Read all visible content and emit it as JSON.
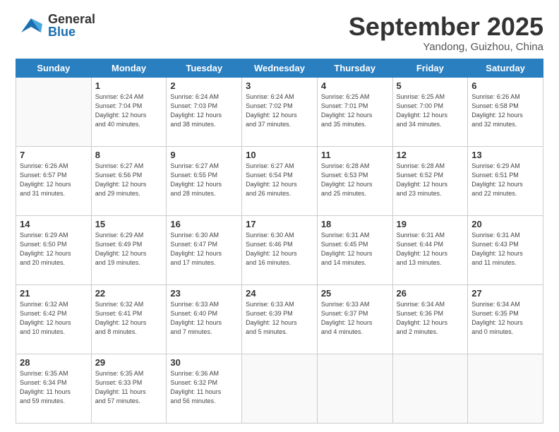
{
  "header": {
    "logo_general": "General",
    "logo_blue": "Blue",
    "month": "September 2025",
    "location": "Yandong, Guizhou, China"
  },
  "weekdays": [
    "Sunday",
    "Monday",
    "Tuesday",
    "Wednesday",
    "Thursday",
    "Friday",
    "Saturday"
  ],
  "weeks": [
    [
      {
        "day": "",
        "info": ""
      },
      {
        "day": "1",
        "info": "Sunrise: 6:24 AM\nSunset: 7:04 PM\nDaylight: 12 hours\nand 40 minutes."
      },
      {
        "day": "2",
        "info": "Sunrise: 6:24 AM\nSunset: 7:03 PM\nDaylight: 12 hours\nand 38 minutes."
      },
      {
        "day": "3",
        "info": "Sunrise: 6:24 AM\nSunset: 7:02 PM\nDaylight: 12 hours\nand 37 minutes."
      },
      {
        "day": "4",
        "info": "Sunrise: 6:25 AM\nSunset: 7:01 PM\nDaylight: 12 hours\nand 35 minutes."
      },
      {
        "day": "5",
        "info": "Sunrise: 6:25 AM\nSunset: 7:00 PM\nDaylight: 12 hours\nand 34 minutes."
      },
      {
        "day": "6",
        "info": "Sunrise: 6:26 AM\nSunset: 6:58 PM\nDaylight: 12 hours\nand 32 minutes."
      }
    ],
    [
      {
        "day": "7",
        "info": "Sunrise: 6:26 AM\nSunset: 6:57 PM\nDaylight: 12 hours\nand 31 minutes."
      },
      {
        "day": "8",
        "info": "Sunrise: 6:27 AM\nSunset: 6:56 PM\nDaylight: 12 hours\nand 29 minutes."
      },
      {
        "day": "9",
        "info": "Sunrise: 6:27 AM\nSunset: 6:55 PM\nDaylight: 12 hours\nand 28 minutes."
      },
      {
        "day": "10",
        "info": "Sunrise: 6:27 AM\nSunset: 6:54 PM\nDaylight: 12 hours\nand 26 minutes."
      },
      {
        "day": "11",
        "info": "Sunrise: 6:28 AM\nSunset: 6:53 PM\nDaylight: 12 hours\nand 25 minutes."
      },
      {
        "day": "12",
        "info": "Sunrise: 6:28 AM\nSunset: 6:52 PM\nDaylight: 12 hours\nand 23 minutes."
      },
      {
        "day": "13",
        "info": "Sunrise: 6:29 AM\nSunset: 6:51 PM\nDaylight: 12 hours\nand 22 minutes."
      }
    ],
    [
      {
        "day": "14",
        "info": "Sunrise: 6:29 AM\nSunset: 6:50 PM\nDaylight: 12 hours\nand 20 minutes."
      },
      {
        "day": "15",
        "info": "Sunrise: 6:29 AM\nSunset: 6:49 PM\nDaylight: 12 hours\nand 19 minutes."
      },
      {
        "day": "16",
        "info": "Sunrise: 6:30 AM\nSunset: 6:47 PM\nDaylight: 12 hours\nand 17 minutes."
      },
      {
        "day": "17",
        "info": "Sunrise: 6:30 AM\nSunset: 6:46 PM\nDaylight: 12 hours\nand 16 minutes."
      },
      {
        "day": "18",
        "info": "Sunrise: 6:31 AM\nSunset: 6:45 PM\nDaylight: 12 hours\nand 14 minutes."
      },
      {
        "day": "19",
        "info": "Sunrise: 6:31 AM\nSunset: 6:44 PM\nDaylight: 12 hours\nand 13 minutes."
      },
      {
        "day": "20",
        "info": "Sunrise: 6:31 AM\nSunset: 6:43 PM\nDaylight: 12 hours\nand 11 minutes."
      }
    ],
    [
      {
        "day": "21",
        "info": "Sunrise: 6:32 AM\nSunset: 6:42 PM\nDaylight: 12 hours\nand 10 minutes."
      },
      {
        "day": "22",
        "info": "Sunrise: 6:32 AM\nSunset: 6:41 PM\nDaylight: 12 hours\nand 8 minutes."
      },
      {
        "day": "23",
        "info": "Sunrise: 6:33 AM\nSunset: 6:40 PM\nDaylight: 12 hours\nand 7 minutes."
      },
      {
        "day": "24",
        "info": "Sunrise: 6:33 AM\nSunset: 6:39 PM\nDaylight: 12 hours\nand 5 minutes."
      },
      {
        "day": "25",
        "info": "Sunrise: 6:33 AM\nSunset: 6:37 PM\nDaylight: 12 hours\nand 4 minutes."
      },
      {
        "day": "26",
        "info": "Sunrise: 6:34 AM\nSunset: 6:36 PM\nDaylight: 12 hours\nand 2 minutes."
      },
      {
        "day": "27",
        "info": "Sunrise: 6:34 AM\nSunset: 6:35 PM\nDaylight: 12 hours\nand 0 minutes."
      }
    ],
    [
      {
        "day": "28",
        "info": "Sunrise: 6:35 AM\nSunset: 6:34 PM\nDaylight: 11 hours\nand 59 minutes."
      },
      {
        "day": "29",
        "info": "Sunrise: 6:35 AM\nSunset: 6:33 PM\nDaylight: 11 hours\nand 57 minutes."
      },
      {
        "day": "30",
        "info": "Sunrise: 6:36 AM\nSunset: 6:32 PM\nDaylight: 11 hours\nand 56 minutes."
      },
      {
        "day": "",
        "info": ""
      },
      {
        "day": "",
        "info": ""
      },
      {
        "day": "",
        "info": ""
      },
      {
        "day": "",
        "info": ""
      }
    ]
  ]
}
